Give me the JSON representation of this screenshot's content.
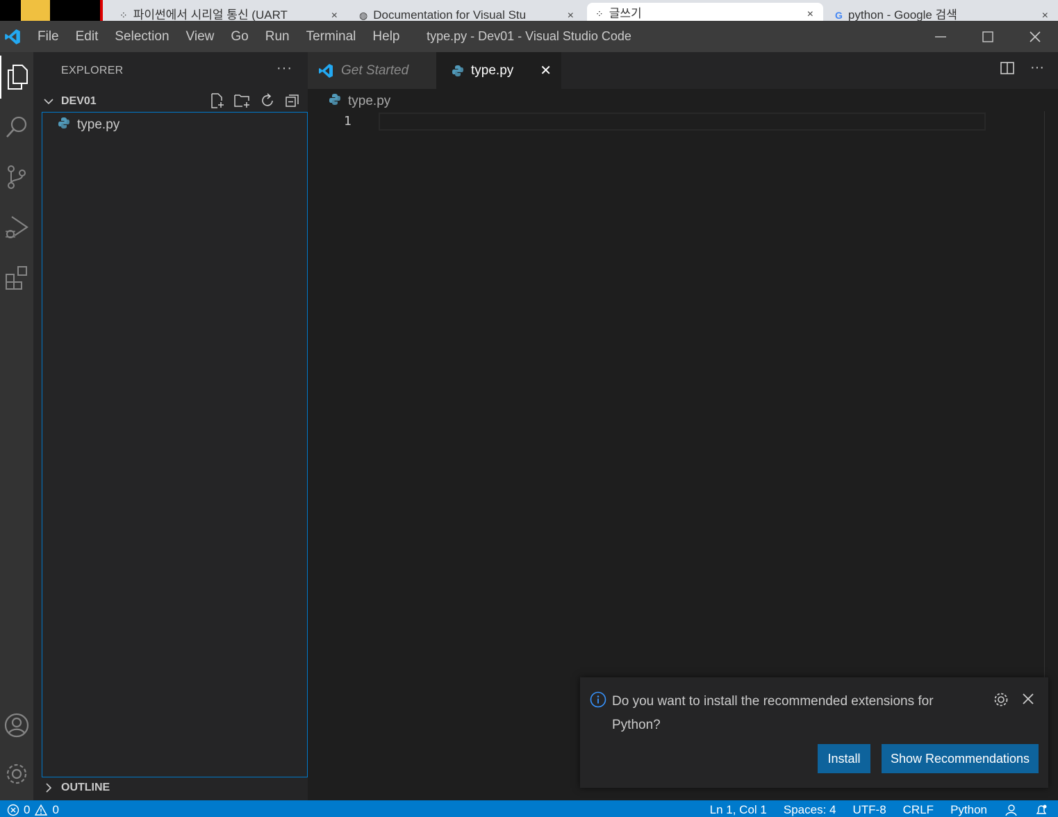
{
  "browser_tabs": [
    {
      "title": "파이썬에서 시리얼 통신 (UART",
      "close": "×"
    },
    {
      "title": "Documentation for Visual Stu",
      "close": "×"
    },
    {
      "title": "글쓰기",
      "close": "×"
    },
    {
      "title": "python - Google 검색",
      "close": "×"
    }
  ],
  "menu": [
    "File",
    "Edit",
    "Selection",
    "View",
    "Go",
    "Run",
    "Terminal",
    "Help"
  ],
  "window_title": "type.py - Dev01 - Visual Studio Code",
  "window_controls": {
    "minimize": "—",
    "close": "✕"
  },
  "sidebar": {
    "title": "EXPLORER",
    "more": "···",
    "folder": "DEV01",
    "files": [
      "type.py"
    ],
    "outline": "OUTLINE"
  },
  "editor_tabs": [
    {
      "label": "Get Started",
      "active": false
    },
    {
      "label": "type.py",
      "active": true,
      "close": "✕"
    }
  ],
  "tabs_more": "···",
  "breadcrumb": "type.py",
  "editor": {
    "line_numbers": [
      "1"
    ]
  },
  "notification": {
    "message": "Do you want to install the recommended extensions for Python?",
    "install": "Install",
    "show": "Show Recommendations"
  },
  "status": {
    "errors": "0",
    "warnings": "0",
    "position": "Ln 1, Col 1",
    "spaces": "Spaces: 4",
    "encoding": "UTF-8",
    "eol": "CRLF",
    "language": "Python"
  },
  "colors": {
    "accent": "#007acc",
    "button": "#0e639c",
    "titlebar": "#3c3c3c",
    "activitybar": "#333333",
    "sidebar": "#252526",
    "editor": "#1e1e1e"
  }
}
